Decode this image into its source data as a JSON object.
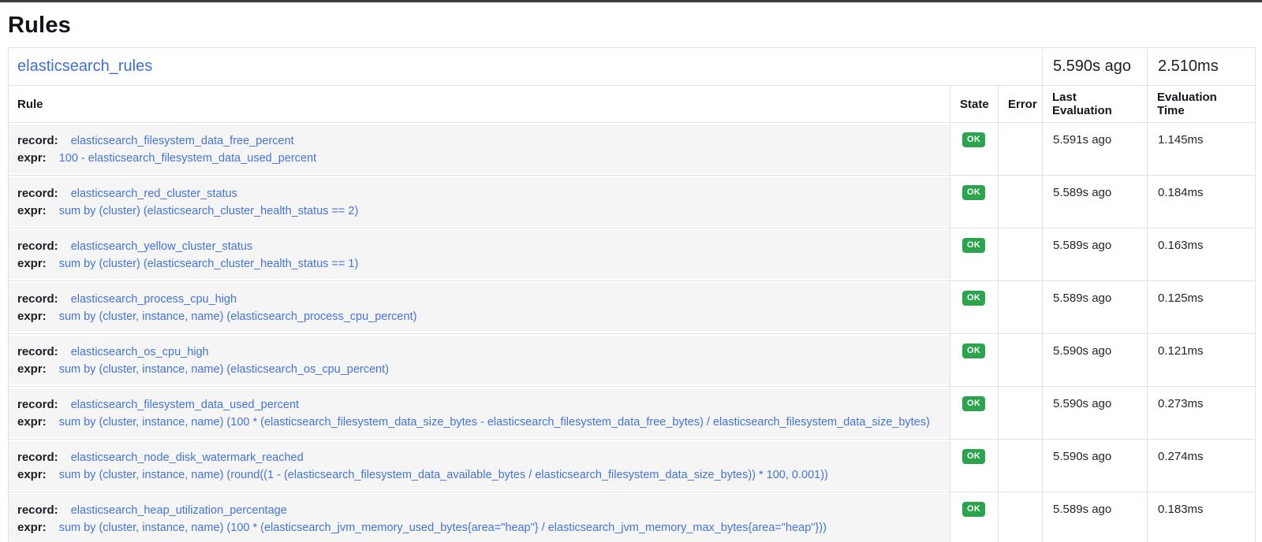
{
  "page": {
    "title": "Rules"
  },
  "group": {
    "name": "elasticsearch_rules",
    "last_evaluation": "5.590s ago",
    "evaluation_time": "2.510ms"
  },
  "table": {
    "columns": [
      "Rule",
      "State",
      "Error",
      "Last Evaluation",
      "Evaluation Time"
    ],
    "labels": {
      "record": "record:",
      "expr": "expr:"
    },
    "rows": [
      {
        "record": "elasticsearch_filesystem_data_free_percent",
        "expr": "100 - elasticsearch_filesystem_data_used_percent",
        "state": "OK",
        "error": "",
        "last_evaluation": "5.591s ago",
        "evaluation_time": "1.145ms"
      },
      {
        "record": "elasticsearch_red_cluster_status",
        "expr": "sum by (cluster) (elasticsearch_cluster_health_status == 2)",
        "state": "OK",
        "error": "",
        "last_evaluation": "5.589s ago",
        "evaluation_time": "0.184ms"
      },
      {
        "record": "elasticsearch_yellow_cluster_status",
        "expr": "sum by (cluster) (elasticsearch_cluster_health_status == 1)",
        "state": "OK",
        "error": "",
        "last_evaluation": "5.589s ago",
        "evaluation_time": "0.163ms"
      },
      {
        "record": "elasticsearch_process_cpu_high",
        "expr": "sum by (cluster, instance, name) (elasticsearch_process_cpu_percent)",
        "state": "OK",
        "error": "",
        "last_evaluation": "5.589s ago",
        "evaluation_time": "0.125ms"
      },
      {
        "record": "elasticsearch_os_cpu_high",
        "expr": "sum by (cluster, instance, name) (elasticsearch_os_cpu_percent)",
        "state": "OK",
        "error": "",
        "last_evaluation": "5.590s ago",
        "evaluation_time": "0.121ms"
      },
      {
        "record": "elasticsearch_filesystem_data_used_percent",
        "expr": "sum by (cluster, instance, name) (100 * (elasticsearch_filesystem_data_size_bytes - elasticsearch_filesystem_data_free_bytes) / elasticsearch_filesystem_data_size_bytes)",
        "state": "OK",
        "error": "",
        "last_evaluation": "5.590s ago",
        "evaluation_time": "0.273ms"
      },
      {
        "record": "elasticsearch_node_disk_watermark_reached",
        "expr": "sum by (cluster, instance, name) (round((1 - (elasticsearch_filesystem_data_available_bytes / elasticsearch_filesystem_data_size_bytes)) * 100, 0.001))",
        "state": "OK",
        "error": "",
        "last_evaluation": "5.590s ago",
        "evaluation_time": "0.274ms"
      },
      {
        "record": "elasticsearch_heap_utilization_percentage",
        "expr": "sum by (cluster, instance, name) (100 * (elasticsearch_jvm_memory_used_bytes{area=\"heap\"} / elasticsearch_jvm_memory_max_bytes{area=\"heap\"}))",
        "state": "OK",
        "error": "",
        "last_evaluation": "5.589s ago",
        "evaluation_time": "0.183ms"
      }
    ]
  },
  "colors": {
    "link_blue": "#4473dd",
    "badge_green": "#2ca44d",
    "rule_cell_gray": "#f5f5f6",
    "border_gray": "#dee2e6",
    "top_edge_dark": "#3d3d3f"
  }
}
